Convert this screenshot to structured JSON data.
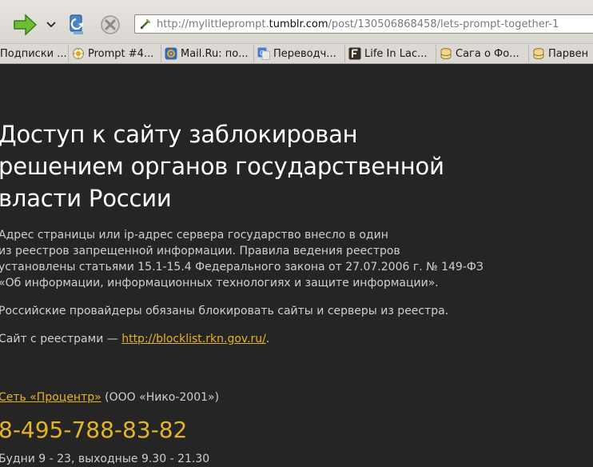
{
  "browser": {
    "url_prefix": "http://mylittleprompt.",
    "url_domain": "tumblr.com",
    "url_path": "/post/130506868458/lets-prompt-together-1",
    "bookmarks": [
      {
        "label": "Подписки ...",
        "icon": "none"
      },
      {
        "label": "Prompt #4...",
        "icon": "sun-icon"
      },
      {
        "label": "Mail.Ru: по...",
        "icon": "mailru-icon"
      },
      {
        "label": "Переводч...",
        "icon": "translate-icon"
      },
      {
        "label": "Life In Lac...",
        "icon": "letter-f-icon"
      },
      {
        "label": "Сага о Фо...",
        "icon": "database-icon"
      },
      {
        "label": "Парвен",
        "icon": "database-icon"
      }
    ]
  },
  "page": {
    "title_lines": [
      "Доступ к сайту заблокирован",
      "решением органов государственной",
      "власти России"
    ],
    "paragraph1_lines": [
      "Адрес страницы или ip-адрес сервера государство внесло в один",
      "из реестров запрещенной информации. Правила ведения реестров",
      "установлены статьями 15.1-15.4 Федерального закона от 27.07.2006 г. № 149-ФЗ",
      "«Об информации, информационных технологиях и защите информации»."
    ],
    "paragraph2": "Российские провайдеры обязаны блокировать сайты и серверы из реестра.",
    "registry_prefix": "Сайт с реестрами — ",
    "registry_link": "http://blocklist.rkn.gov.ru/",
    "registry_suffix": ".",
    "provider_link": "Сеть «Процентр»",
    "provider_suffix": " (ООО «Нико-2001»)",
    "phone": "8-495-788-83-82",
    "hours": "Будни 9 - 23, выходные 9.30 - 21.30"
  },
  "colors": {
    "background": "#252525",
    "accent": "#e6b422",
    "heading": "#ffffff",
    "text": "#cfcfcf"
  }
}
